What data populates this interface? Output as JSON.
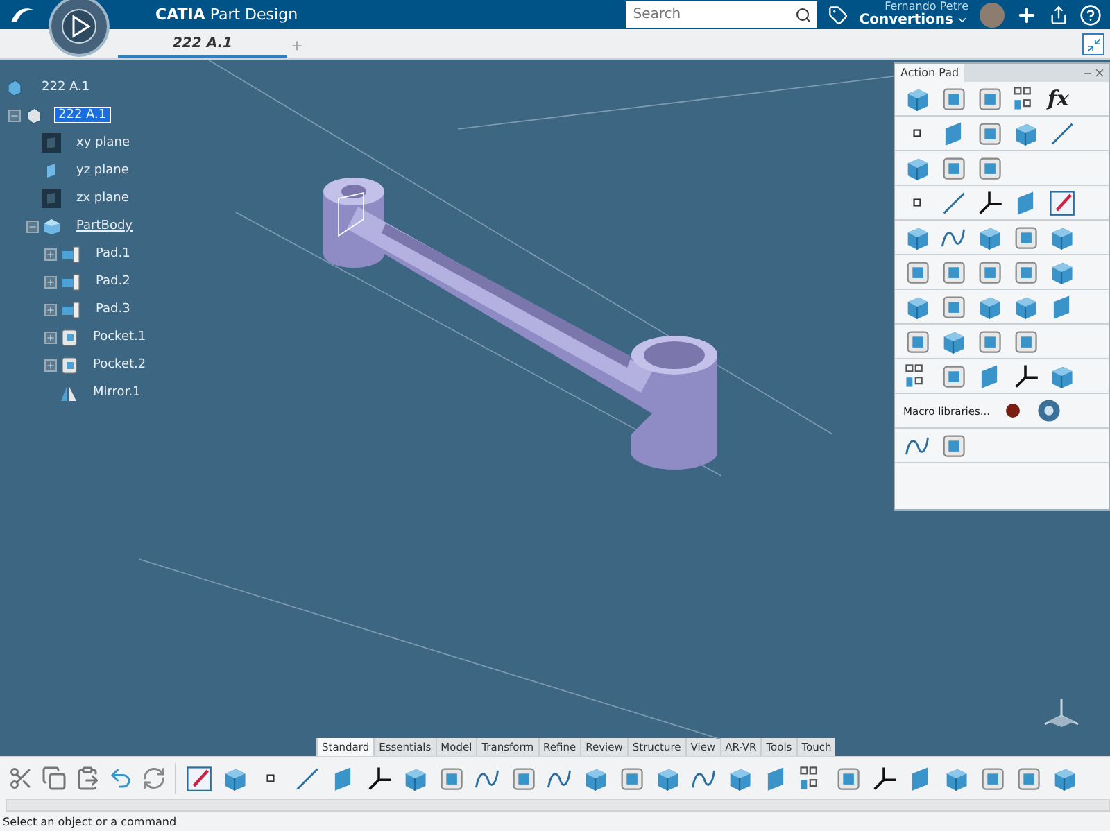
{
  "header": {
    "brand": "CATIA",
    "app": "Part Design",
    "search": {
      "placeholder": "Search"
    },
    "user": "Fernando Petre",
    "workspace": "Convertions"
  },
  "tabs": [
    {
      "label": "222 A.1",
      "selected": true
    }
  ],
  "tree": {
    "label": "222 A.1",
    "kind": "product",
    "children": [
      {
        "label": "222 A.1",
        "kind": "part",
        "selected": true,
        "expanded": true,
        "children": [
          {
            "label": "xy plane",
            "kind": "plane_dark"
          },
          {
            "label": "yz plane",
            "kind": "plane"
          },
          {
            "label": "zx plane",
            "kind": "plane_dark"
          },
          {
            "label": "PartBody",
            "kind": "body",
            "in_work": true,
            "expanded": true,
            "children": [
              {
                "label": "Pad.1",
                "kind": "pad",
                "expanded": false
              },
              {
                "label": "Pad.2",
                "kind": "pad",
                "expanded": false
              },
              {
                "label": "Pad.3",
                "kind": "pad",
                "expanded": false
              },
              {
                "label": "Pocket.1",
                "kind": "pocket",
                "expanded": false
              },
              {
                "label": "Pocket.2",
                "kind": "pocket",
                "expanded": false
              },
              {
                "label": "Mirror.1",
                "kind": "mirror"
              }
            ]
          }
        ]
      }
    ]
  },
  "action_pad": {
    "title": "Action Pad",
    "formula_label": "fx",
    "macro_label": "Macro libraries..."
  },
  "toolbar_tabs": [
    {
      "label": "Standard",
      "selected": true
    },
    {
      "label": "Essentials",
      "selected": false
    },
    {
      "label": "Model",
      "selected": false
    },
    {
      "label": "Transform",
      "selected": false
    },
    {
      "label": "Refine",
      "selected": false
    },
    {
      "label": "Review",
      "selected": false
    },
    {
      "label": "Structure",
      "selected": false
    },
    {
      "label": "View",
      "selected": false
    },
    {
      "label": "AR-VR",
      "selected": false
    },
    {
      "label": "Tools",
      "selected": false
    },
    {
      "label": "Touch",
      "selected": false
    }
  ],
  "status_bar": {
    "message": "Select an object or a command"
  }
}
